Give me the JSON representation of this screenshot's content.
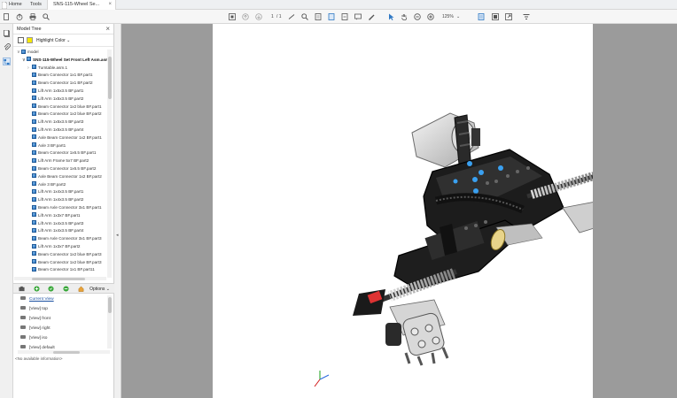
{
  "tabs": {
    "home": "Home",
    "tools": "Tools",
    "document": "SNS-115-Wheel Se..."
  },
  "toolbar": {
    "page_current": "1",
    "page_sep": "/ 1",
    "zoom": "125%"
  },
  "panel": {
    "title": "Model Tree",
    "highlight_label": "Highlight Color",
    "tree": [
      {
        "label": "model",
        "level": 0,
        "toggle": "∨"
      },
      {
        "label": "SNS-115-Wheel Set Front Left Asm.asm",
        "level": 1,
        "toggle": "∨",
        "bold": true
      },
      {
        "label": "Turntable.asm.1",
        "level": 2,
        "toggle": "›"
      },
      {
        "label": "Beam Connector 1x1 BF.part1",
        "level": 2
      },
      {
        "label": "Beam Connector 1x1 BF.part2",
        "level": 2
      },
      {
        "label": "Lift Arm 1x5x3.5 BF.part1",
        "level": 2
      },
      {
        "label": "Lift Arm 1x5x3.5 BF.part2",
        "level": 2
      },
      {
        "label": "Beam Connector 1x2 blue BF.part1",
        "level": 2
      },
      {
        "label": "Beam Connector 1x2 blue BF.part2",
        "level": 2
      },
      {
        "label": "Lift Arm 1x5x3.5 BF.part3",
        "level": 2
      },
      {
        "label": "Lift Arm 1x5x3.5 BF.part4",
        "level": 2
      },
      {
        "label": "Axle Beam Connector 1x2 BF.part1",
        "level": 2
      },
      {
        "label": "Axle 3 BF.part1",
        "level": 2
      },
      {
        "label": "Beam Connector 1x6.5 BF.part1",
        "level": 2
      },
      {
        "label": "Lift Arm Frame 5x7 BF.part2",
        "level": 2
      },
      {
        "label": "Beam Connector 1x6.5 BF.part2",
        "level": 2
      },
      {
        "label": "Axle Beam Connector 1x2 BF.part2",
        "level": 2
      },
      {
        "label": "Axle 3 BF.part2",
        "level": 2
      },
      {
        "label": "Lift Arm 1x4x3.5 BF.part1",
        "level": 2
      },
      {
        "label": "Lift Arm 1x4x3.5 BF.part2",
        "level": 2
      },
      {
        "label": "Beam Axle Connector 3x1 BF.part1",
        "level": 2
      },
      {
        "label": "Lift Arm 1x3x7 BF.part1",
        "level": 2
      },
      {
        "label": "Lift Arm 1x4x3.5 BF.part3",
        "level": 2
      },
      {
        "label": "Lift Arm 1x4x3.5 BF.part4",
        "level": 2
      },
      {
        "label": "Beam Axle Connector 3x1 BF.part3",
        "level": 2
      },
      {
        "label": "Lift Arm 1x3x7 BF.part2",
        "level": 2
      },
      {
        "label": "Beam Connector 1x2 blue BF.part3",
        "level": 2
      },
      {
        "label": "Beam Connector 1x2 blue BF.part3",
        "level": 2
      },
      {
        "label": "Beam Connector 1x1 BF.part11",
        "level": 2
      }
    ],
    "views_options": "Options",
    "views": [
      {
        "label": "Current View",
        "link": true
      },
      {
        "label": "[View] top"
      },
      {
        "label": "[View] front"
      },
      {
        "label": "[View] right"
      },
      {
        "label": "[View] iso"
      },
      {
        "label": "[View] default"
      }
    ],
    "props": "<No available information>"
  },
  "colors": {
    "highlight": "#f6e800",
    "doc_background": "#9b9b9b",
    "page": "#ffffff",
    "accent": "#2f78c4"
  }
}
